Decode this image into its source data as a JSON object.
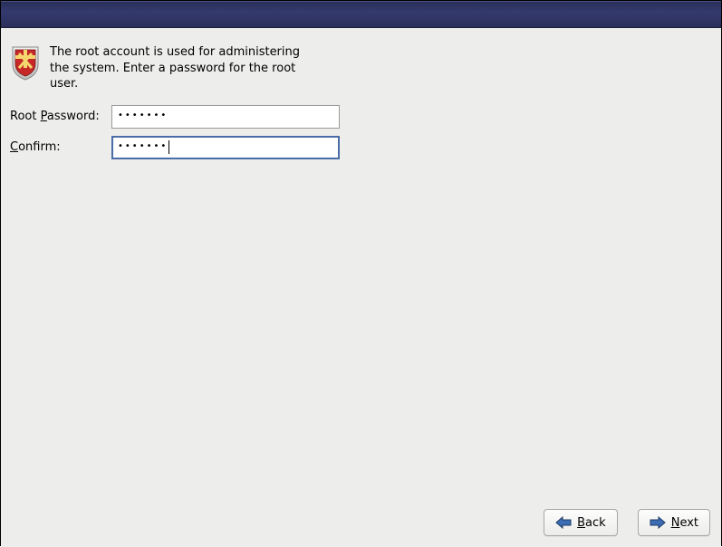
{
  "intro": {
    "text": "The root account is used for administering the system.  Enter a password for the root user."
  },
  "form": {
    "password_label_pre": "Root ",
    "password_label_accel": "P",
    "password_label_post": "assword:",
    "confirm_label_accel": "C",
    "confirm_label_post": "onfirm:",
    "password_value": "•••••••",
    "confirm_value": "•••••••"
  },
  "buttons": {
    "back_accel": "B",
    "back_post": "ack",
    "next_accel": "N",
    "next_post": "ext"
  }
}
